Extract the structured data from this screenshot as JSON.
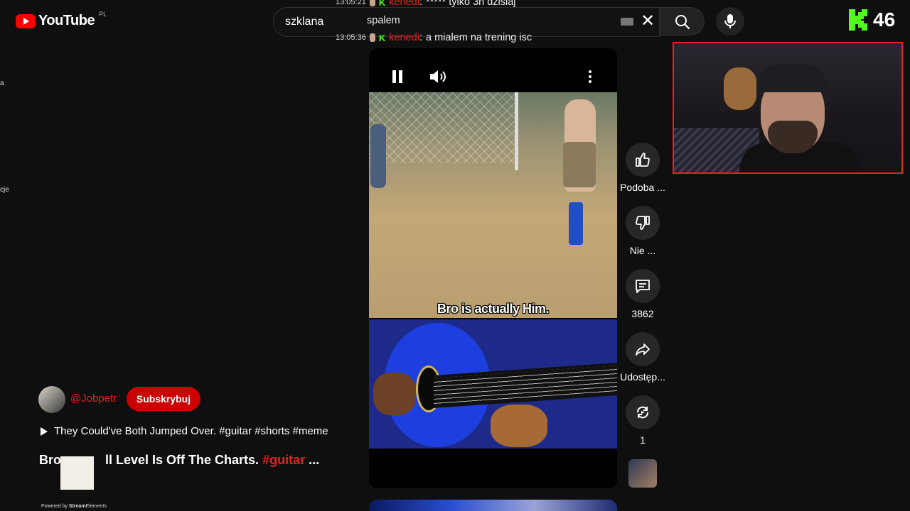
{
  "header": {
    "logo_text": "YouTube",
    "logo_region": "PL",
    "search": {
      "query": "szklana",
      "clear_icon": "close-icon"
    },
    "search_button_icon": "search-icon",
    "mic_icon": "mic-icon"
  },
  "chat": [
    {
      "time": "13:05:21",
      "user": "kenedi",
      "sep": ":",
      "message": "***** tylko 3h dzisiaj"
    },
    {
      "time": "",
      "user": "",
      "sep": "",
      "message": "spalem"
    },
    {
      "time": "13:05:36",
      "user": "kenedi",
      "sep": ":",
      "message": "a mialem na trening isc"
    }
  ],
  "kick": {
    "viewer_count": "46",
    "accent": "#53fc18"
  },
  "sidebar_fragments": [
    "a",
    "cje"
  ],
  "player": {
    "caption": "Bro is actually Him.",
    "pause_icon": "pause-icon",
    "volume_icon": "volume-icon",
    "more_icon": "more-vert-icon"
  },
  "actions": [
    {
      "icon": "thumbs-up-icon",
      "label": "Podoba ..."
    },
    {
      "icon": "thumbs-down-icon",
      "label": "Nie ..."
    },
    {
      "icon": "comment-icon",
      "label": "3862"
    },
    {
      "icon": "share-icon",
      "label": "Udostęp..."
    },
    {
      "icon": "remix-icon",
      "label": "1"
    }
  ],
  "channel": {
    "handle": "@Jobpetr",
    "subscribe_label": "Subskrybuj"
  },
  "playlist_line": "They Could've Both Jumped Over. #guitar #shorts #meme",
  "title": {
    "prefix": "Bro",
    "rest": "ll Level Is Off The Charts.",
    "tag": "#guitar",
    "ellipsis": "..."
  },
  "powered_by": {
    "prefix": "Powered by",
    "brand_bold": "Stream",
    "brand_rest": "Elements"
  },
  "colors": {
    "background": "#0f0f0f",
    "youtube_red": "#ff0000",
    "subscribe_red": "#cc0000",
    "link_red": "#e0241c"
  }
}
